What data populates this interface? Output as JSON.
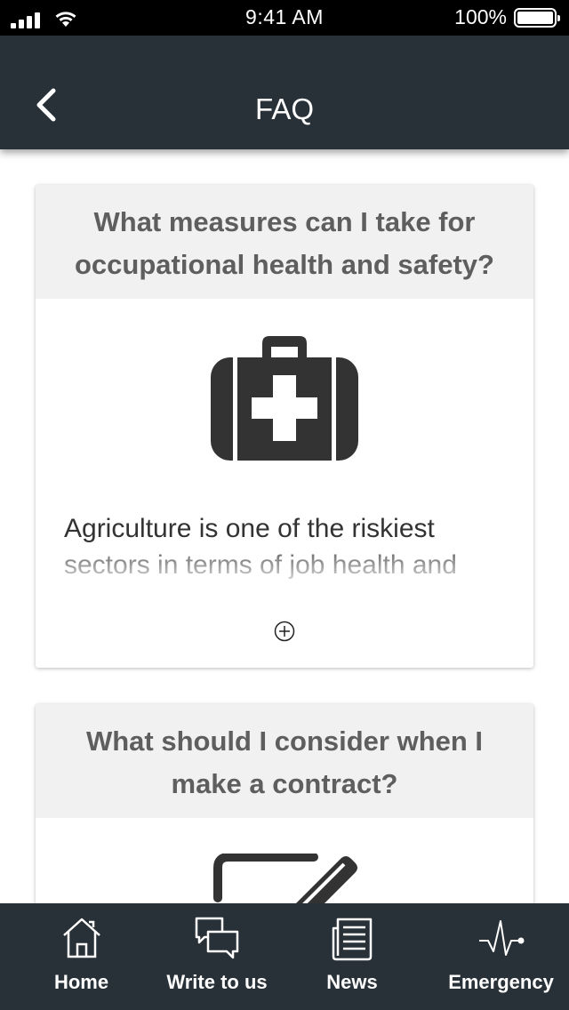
{
  "status_bar": {
    "time": "9:41 AM",
    "battery": "100%",
    "icons": [
      "signal-icon",
      "wifi-icon",
      "battery-icon"
    ]
  },
  "header": {
    "title": "FAQ",
    "back_icon": "chevron-left-icon",
    "background_color": "#283138"
  },
  "faq": {
    "items": [
      {
        "question": "What measures can I take for occupational health and safety?",
        "icon": "first-aid-kit-icon",
        "excerpt": "Agriculture is one of the riskiest sectors in terms of job health and",
        "expand_icon": "plus-circle-icon"
      },
      {
        "question": "What should I consider when I make a contract?",
        "icon": "contract-edit-icon"
      }
    ]
  },
  "tab_bar": {
    "tabs": [
      {
        "label": "Home",
        "icon": "home-icon"
      },
      {
        "label": "Write to us",
        "icon": "chat-icon"
      },
      {
        "label": "News",
        "icon": "newspaper-icon"
      },
      {
        "label": "Emergency",
        "icon": "heartbeat-icon"
      }
    ]
  }
}
